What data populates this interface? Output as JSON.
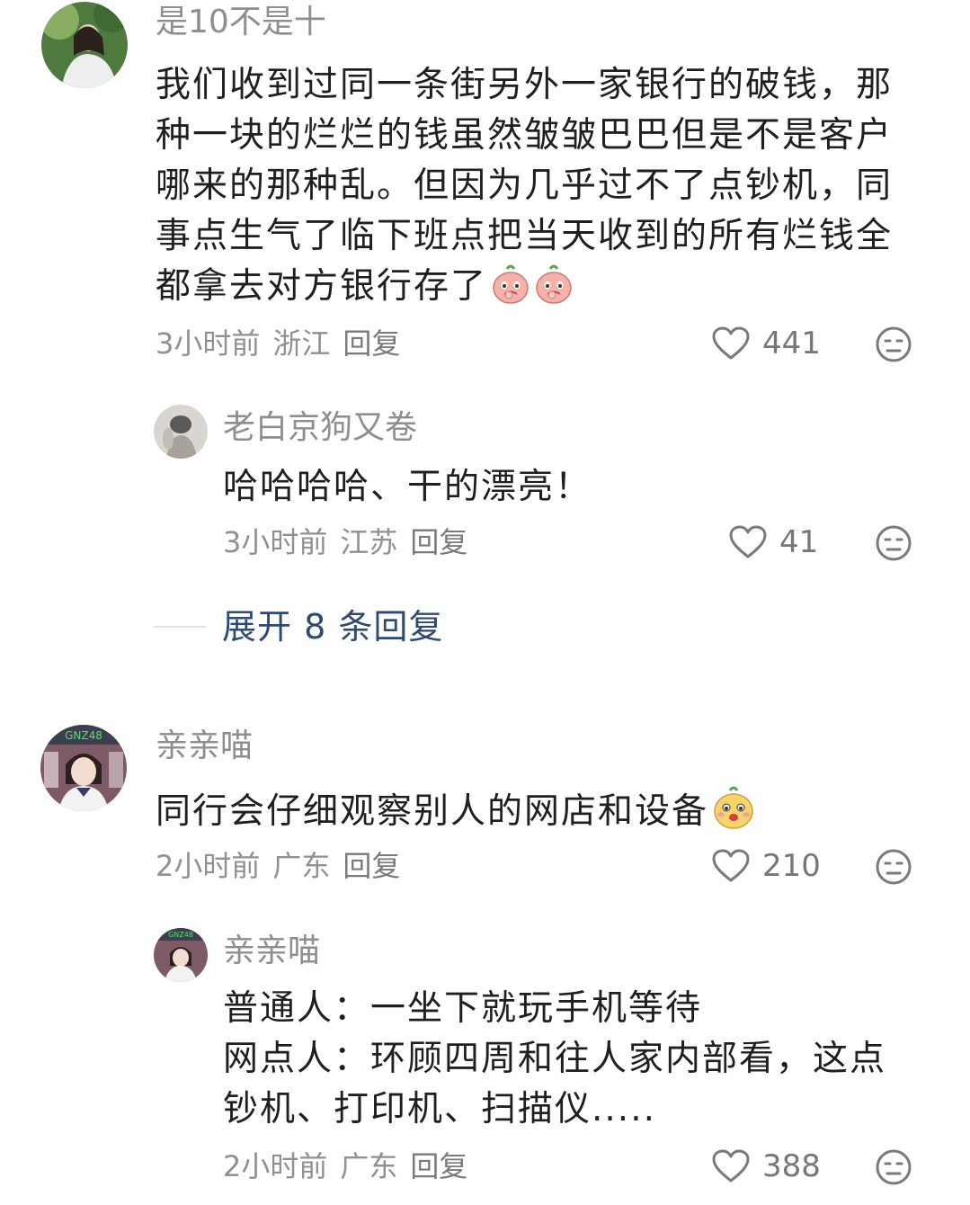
{
  "comments": [
    {
      "username": "是10不是十",
      "text": "我们收到过同一条街另外一家银行的破钱，那种一块的烂烂的钱虽然皱皱巴巴但是不是客户哪来的那种乱。但因为几乎过不了点钞机，同事点生气了临下班点把当天收到的所有烂钱全都拿去对方银行存了",
      "emoji": [
        "pink-bun-emoji",
        "pink-bun-emoji"
      ],
      "time": "3小时前",
      "location": "浙江",
      "reply_label": "回复",
      "likes": "441"
    },
    {
      "username": "老白京狗又卷",
      "text": "哈哈哈哈、干的漂亮！",
      "time": "3小时前",
      "location": "江苏",
      "reply_label": "回复",
      "likes": "41"
    },
    {
      "username": "亲亲喵",
      "text": "同行会仔细观察别人的网店和设备",
      "emoji": [
        "yellow-bun-emoji"
      ],
      "time": "2小时前",
      "location": "广东",
      "reply_label": "回复",
      "likes": "210"
    },
    {
      "username": "亲亲喵",
      "text": "普通人：一坐下就玩手机等待\n网点人：环顾四周和往人家内部看，这点钞机、打印机、扫描仪.....",
      "time": "2小时前",
      "location": "广东",
      "reply_label": "回复",
      "likes": "388"
    }
  ],
  "expand_replies": "展开 8 条回复",
  "avatar_badge": "GNZ48",
  "colors": {
    "username": "#8e8e8e",
    "body": "#1f1f1f",
    "meta": "#909090",
    "expand": "#2f4a70",
    "emoji_pink": "#f6b2a9",
    "emoji_yellow": "#f7d46a"
  }
}
